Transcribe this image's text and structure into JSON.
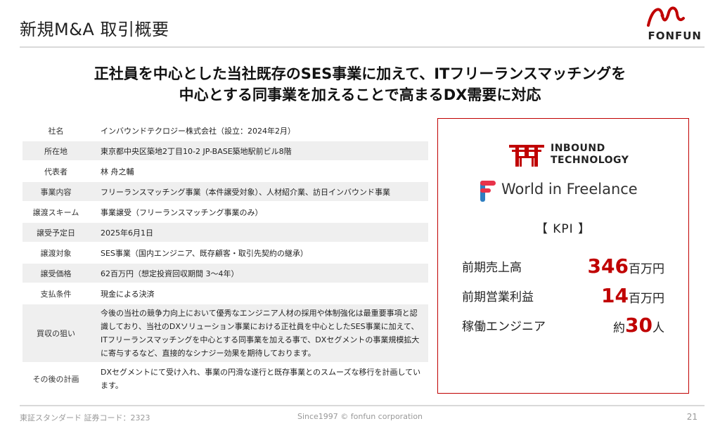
{
  "header": {
    "title": "新規M&A 取引概要",
    "brand_name": "FONFUN"
  },
  "headline": {
    "line1": "正社員を中心とした当社既存のSES事業に加えて、ITフリーランスマッチングを",
    "line2": "中心とする同事業を加えることで高まるDX需要に対応"
  },
  "company_table": [
    {
      "label": "社名",
      "value": "インバウンドテクロジー株式会社（設立：2024年2月）"
    },
    {
      "label": "所在地",
      "value": "東京都中央区築地2丁目10-2 JP-BASE築地駅前ビル8階"
    },
    {
      "label": "代表者",
      "value": "林 舟之輔"
    },
    {
      "label": "事業内容",
      "value": "フリーランスマッチング事業（本件譲受対象）、人材紹介業、訪日インバウンド事業"
    },
    {
      "label": "譲渡スキーム",
      "value": "事業譲受（フリーランスマッチング事業のみ）"
    },
    {
      "label": "譲受予定日",
      "value": "2025年6月1日"
    },
    {
      "label": "譲渡対象",
      "value": "SES事業（国内エンジニア、既存顧客・取引先契約の継承）"
    },
    {
      "label": "譲受価格",
      "value": "62百万円（想定投資回収期間 3～4年）"
    },
    {
      "label": "支払条件",
      "value": "現金による決済"
    },
    {
      "label": "買収の狙い",
      "value": "今後の当社の競争力向上において優秀なエンジニア人材の採用や体制強化は最重要事項と認識しており、当社のDXソリューション事業における正社員を中心としたSES事業に加えて、ITフリーランスマッチングを中心とする同事業を加える事で、DXセグメントの事業規模拡大に寄与するなど、直接的なシナジー効果を期待しております。"
    },
    {
      "label": "その後の計画",
      "value": "DXセグメントにて受け入れ、事業の円滑な遂行と既存事業とのスムーズな移行を計画しています。"
    }
  ],
  "kpi_panel": {
    "company_logo_line1": "INBOUND",
    "company_logo_line2": "TECHNOLOGY",
    "service_name": "World in Freelance",
    "heading": "【 KPI 】",
    "items": [
      {
        "label": "前期売上高",
        "prefix": "",
        "value": "346",
        "unit": "百万円"
      },
      {
        "label": "前期営業利益",
        "prefix": "",
        "value": "14",
        "unit": "百万円"
      },
      {
        "label": "稼働エンジニア",
        "prefix": "約",
        "value": "30",
        "unit": "人"
      }
    ]
  },
  "footer": {
    "market": "東証スタンダード 証券コード：2323",
    "copyright": "Since1997 © fonfun corporation",
    "page_number": "21"
  },
  "colors": {
    "accent": "#c00000",
    "table_shade": "#efefef",
    "rule": "#d9d9d9",
    "wif_logo_red": "#e8334a",
    "wif_logo_blue": "#2f7ec1"
  }
}
